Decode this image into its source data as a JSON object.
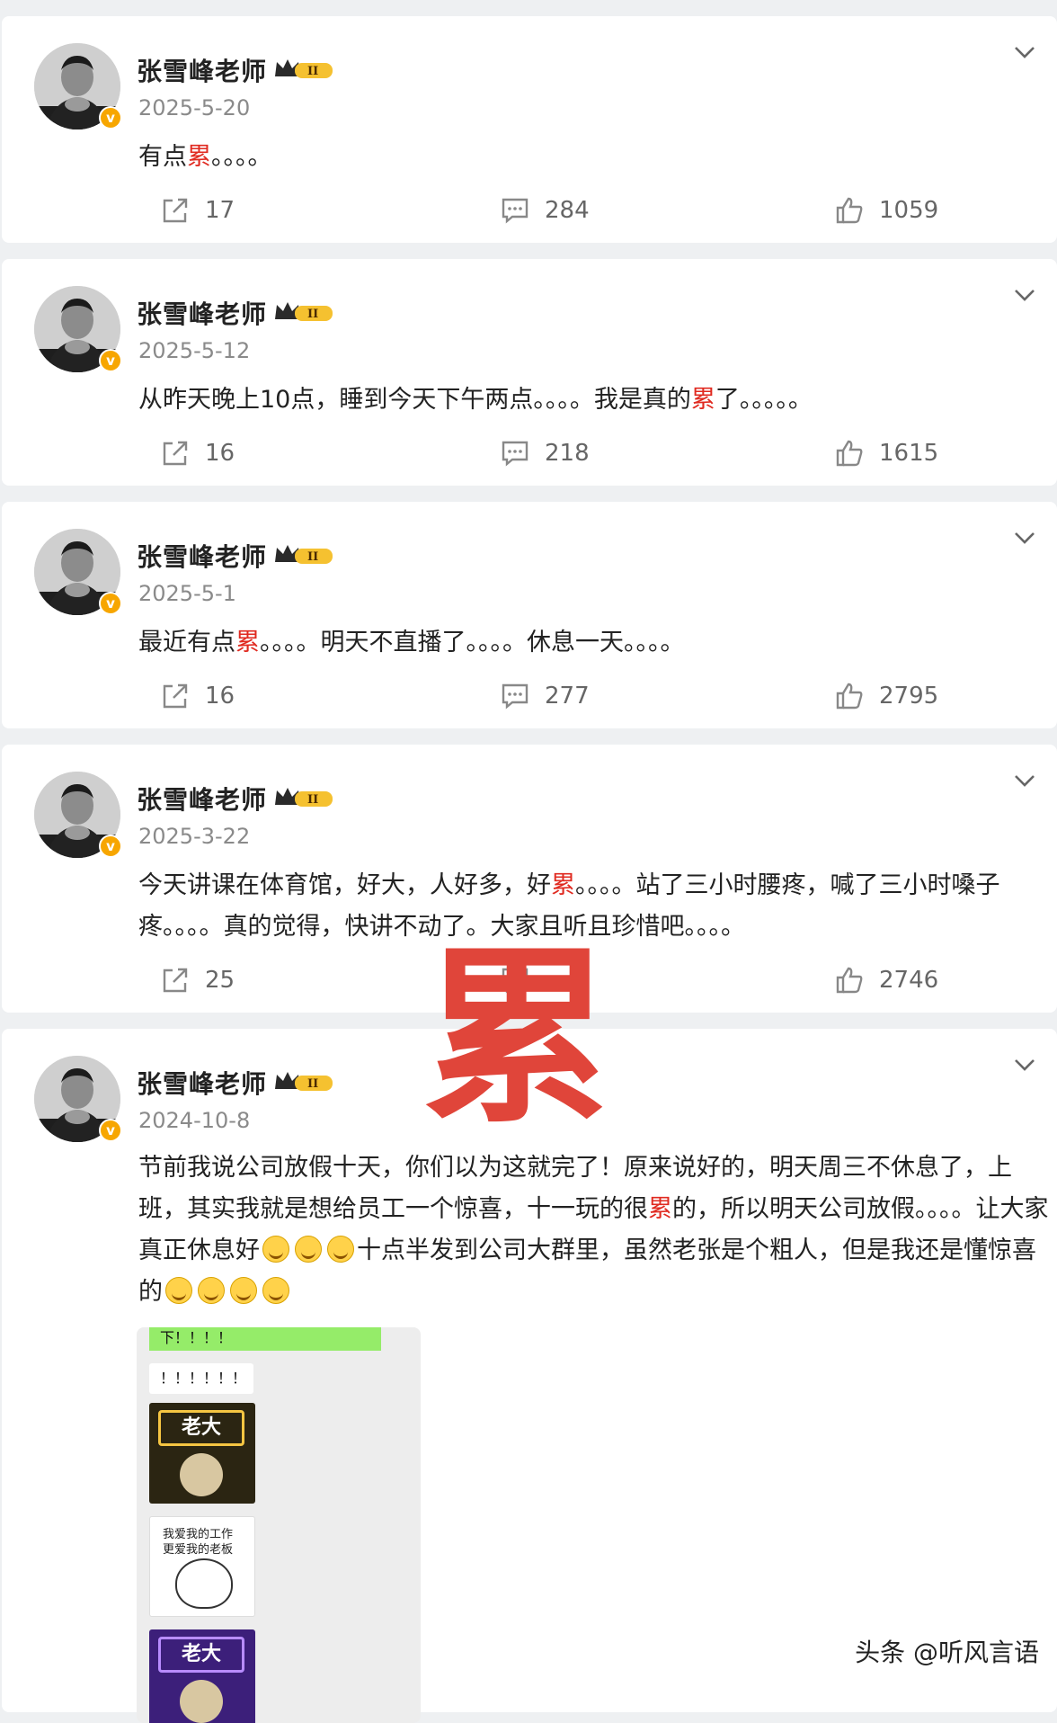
{
  "author": {
    "name": "张雪峰老师",
    "verified_mark": "v"
  },
  "posts": [
    {
      "date": "2025-5-20",
      "text_before": "有点",
      "text_highlight": "累",
      "text_after": "。。。。",
      "shares": "17",
      "comments": "284",
      "likes": "1059"
    },
    {
      "date": "2025-5-12",
      "text_before": "从昨天晚上10点，睡到今天下午两点。。。。我是真的",
      "text_highlight": "累",
      "text_after": "了。。。。。",
      "shares": "16",
      "comments": "218",
      "likes": "1615"
    },
    {
      "date": "2025-5-1",
      "text_before": "最近有点",
      "text_highlight": "累",
      "text_after": "。。。。明天不直播了。。。。休息一天。。。。",
      "shares": "16",
      "comments": "277",
      "likes": "2795"
    },
    {
      "date": "2025-3-22",
      "text_before": "今天讲课在体育馆，好大，人好多，好",
      "text_highlight": "累",
      "text_after": "。。。。站了三小时腰疼，喊了三小时嗓子疼。。。。真的觉得，快讲不动了。大家且听且珍惜吧。。。。",
      "shares": "25",
      "comments": "",
      "likes": "2746"
    },
    {
      "date": "2024-10-8",
      "text_before": "节前我说公司放假十天，你们以为这就完了！原来说好的，明天周三不休息了，上班，其实我就是想给员工一个惊喜，十一玩的很",
      "text_highlight": "累",
      "text_after": "的，所以明天公司放假。。。。让大家真正休息好",
      "text_middle": "十点半发到公司大群里，虽然老张是个粗人，但是我还是懂惊喜的"
    }
  ],
  "watermark": "累",
  "chat": {
    "green_msg": "下！！！！",
    "white_msg": "！！！！！！",
    "sticker_boss_text": "老大",
    "sticker_love_line1": "我爱我的工作",
    "sticker_love_line2": "更爱我的老板",
    "sticker_boss2_text": "老大"
  },
  "footer": "头条 @听风言语",
  "colors": {
    "highlight": "#e02a20",
    "card_bg": "#ffffff",
    "page_bg": "#eef0f2"
  },
  "icons": [
    "share-icon",
    "comment-icon",
    "like-icon",
    "chevron-down-icon",
    "vip-crown-badge",
    "verified-badge",
    "grin-emoji",
    "shush-emoji"
  ]
}
